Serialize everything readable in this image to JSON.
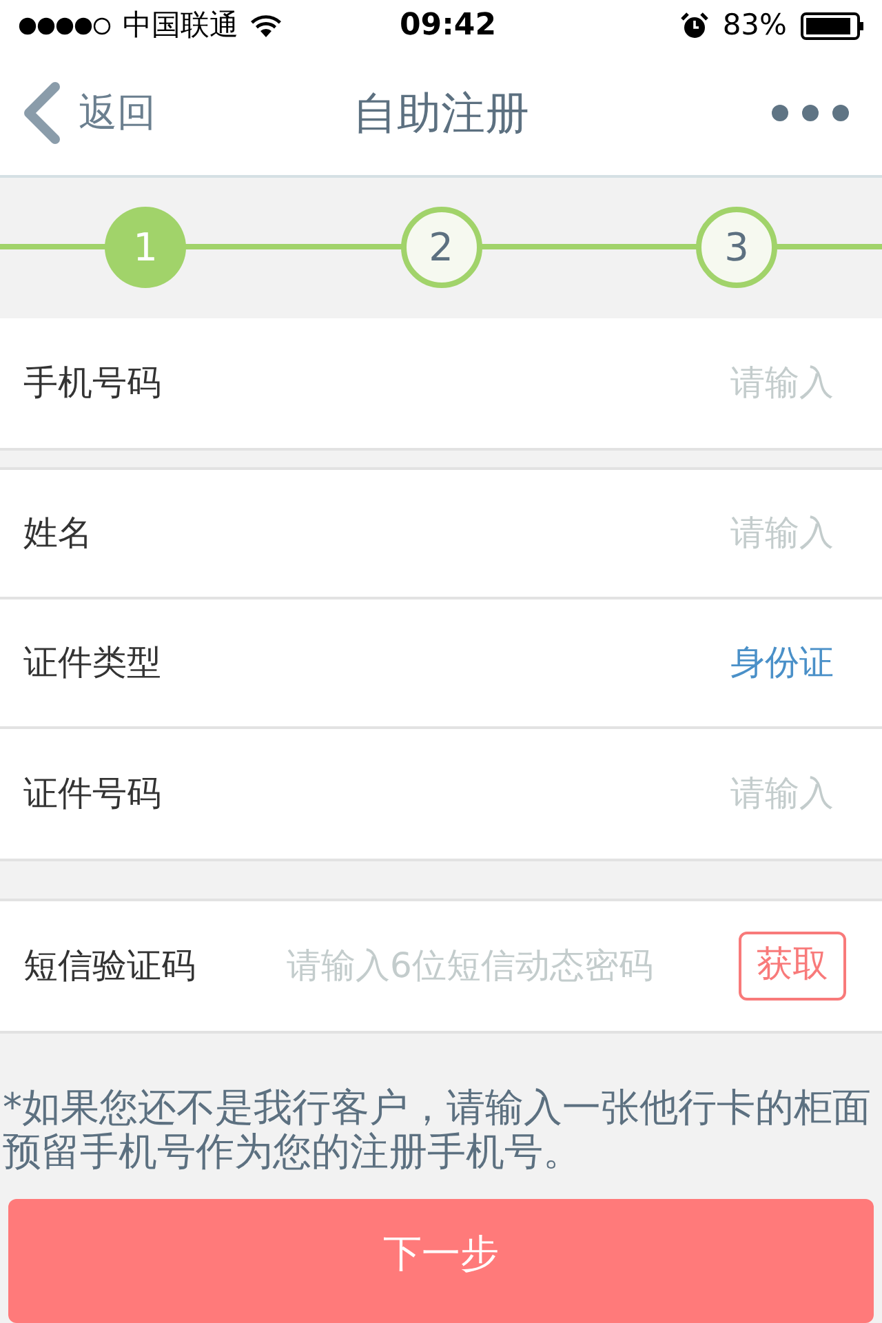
{
  "status_bar": {
    "carrier": "中国联通",
    "time": "09:42",
    "battery": "83%"
  },
  "nav": {
    "back": "返回",
    "title": "自助注册"
  },
  "steps": [
    {
      "label": "1",
      "selected": true
    },
    {
      "label": "2",
      "selected": false
    },
    {
      "label": "3",
      "selected": false
    }
  ],
  "groups": [
    [
      {
        "kind": "input",
        "label": "手机号码",
        "placeholder": "请输入"
      }
    ],
    [
      {
        "kind": "input",
        "label": "姓名",
        "placeholder": "请输入"
      },
      {
        "kind": "select",
        "label": "证件类型",
        "value": "身份证"
      },
      {
        "kind": "input",
        "label": "证件号码",
        "placeholder": "请输入"
      }
    ],
    [
      {
        "kind": "code",
        "label": "短信验证码",
        "placeholder": "请输入6位短信动态密码",
        "button": "获取"
      }
    ]
  ],
  "note": "*如果您还不是我行客户，请输入一张他行卡的柜面预留手机号作为您的注册手机号。",
  "next_button": "下一步"
}
